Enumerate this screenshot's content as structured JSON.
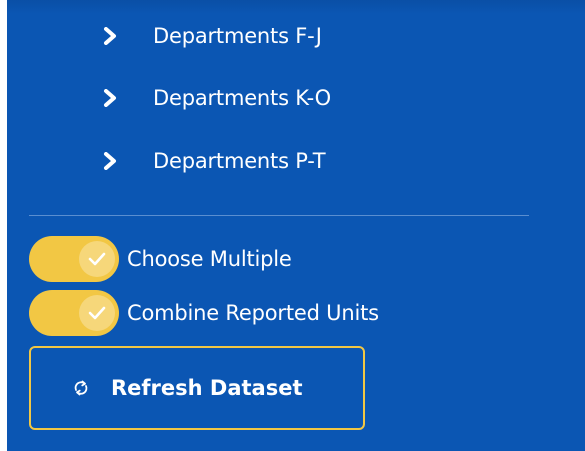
{
  "colors": {
    "panel_bg": "#0b56b3",
    "accent": "#f2c744",
    "text": "#ffffff"
  },
  "departments": [
    {
      "label": "Departments F-J",
      "icon": "chevron-right-icon"
    },
    {
      "label": "Departments K-O",
      "icon": "chevron-right-icon"
    },
    {
      "label": "Departments P-T",
      "icon": "chevron-right-icon"
    }
  ],
  "toggles": [
    {
      "label": "Choose Multiple",
      "checked": true,
      "icon": "check-icon"
    },
    {
      "label": "Combine Reported Units",
      "checked": true,
      "icon": "check-icon"
    }
  ],
  "refresh_button": {
    "label": "Refresh Dataset",
    "icon": "refresh-icon"
  }
}
